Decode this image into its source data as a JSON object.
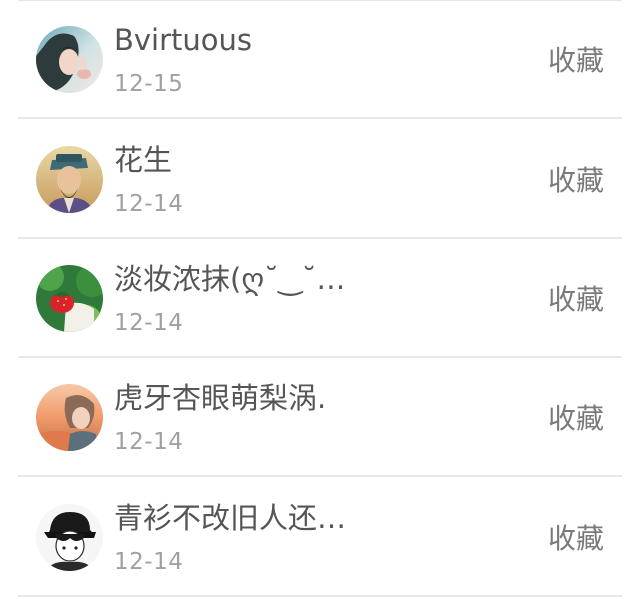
{
  "colors": {
    "name_text": "#555555",
    "date_text": "#a0a0a0",
    "action_text": "#7a7a7a",
    "divider": "#e8e8e8"
  },
  "rows": [
    {
      "name": "Bvirtuous",
      "date": "12-15",
      "action": "收藏",
      "avatar": "avatar-girl-photo"
    },
    {
      "name": "花生",
      "date": "12-14",
      "action": "收藏",
      "avatar": "avatar-ancient-figure"
    },
    {
      "name": "淡妆浓抹(ღ˘‿˘…",
      "date": "12-14",
      "action": "收藏",
      "avatar": "avatar-strawberry-hand"
    },
    {
      "name": "虎牙杏眼萌梨涡.",
      "date": "12-14",
      "action": "收藏",
      "avatar": "avatar-anime-sunset"
    },
    {
      "name": "青衫不改旧人还…",
      "date": "12-14",
      "action": "收藏",
      "avatar": "avatar-cap-boy"
    }
  ]
}
